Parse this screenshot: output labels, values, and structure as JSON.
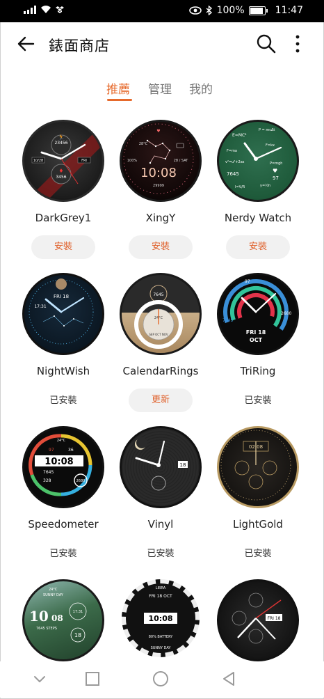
{
  "status": {
    "battery": "100%",
    "time": "11:47"
  },
  "appbar": {
    "title": "錶面商店"
  },
  "tabs": [
    {
      "label": "推薦",
      "active": true
    },
    {
      "label": "管理",
      "active": false
    },
    {
      "label": "我的",
      "active": false
    }
  ],
  "watchfaces": [
    {
      "name": "DarkGrey1",
      "action": "安裝",
      "state": "install",
      "texts": [
        "23456",
        "3456",
        "10/28",
        "FRI"
      ]
    },
    {
      "name": "XingY",
      "action": "安裝",
      "state": "install",
      "texts": [
        "10:08",
        "28 / SAT",
        "29999",
        "100%",
        "28°C"
      ]
    },
    {
      "name": "Nerdy Watch",
      "action": "安裝",
      "state": "install",
      "texts": [
        "7645",
        "97",
        "E=MC²"
      ]
    },
    {
      "name": "NightWish",
      "action": "已安裝",
      "state": "installed",
      "texts": [
        "FRI 18",
        "17:31"
      ]
    },
    {
      "name": "CalendarRings",
      "action": "更新",
      "state": "update",
      "texts": [
        "7645",
        "24°C",
        "SEP OCT NOV"
      ]
    },
    {
      "name": "TriRing",
      "action": "已安裝",
      "state": "installed",
      "texts": [
        "FRI 18",
        "OCT",
        "97",
        "7645",
        "2680"
      ]
    },
    {
      "name": "Speedometer",
      "action": "已安裝",
      "state": "installed",
      "texts": [
        "10:08",
        "7645",
        "328",
        "2680",
        "24°C",
        "97",
        "36"
      ]
    },
    {
      "name": "Vinyl",
      "action": "已安裝",
      "state": "installed",
      "texts": [
        "18"
      ]
    },
    {
      "name": "LightGold",
      "action": "已安裝",
      "state": "installed",
      "texts": [
        "02:08"
      ]
    },
    {
      "name": "",
      "action": "",
      "state": "none",
      "texts": [
        "10",
        "08",
        "7645 STEPS",
        "18",
        "17:31",
        "24°C",
        "SUNNY DAY"
      ]
    },
    {
      "name": "",
      "action": "",
      "state": "none",
      "texts": [
        "10:08",
        "FRI 18 OCT",
        "LIBRA",
        "SUNNY DAY",
        "80% BATTERY"
      ]
    },
    {
      "name": "",
      "action": "",
      "state": "none",
      "texts": [
        "FRI 18"
      ]
    }
  ]
}
